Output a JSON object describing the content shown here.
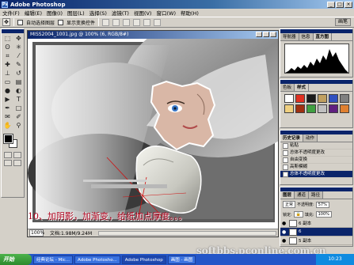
{
  "window": {
    "title": "Adobe Photoshop",
    "min": "_",
    "max": "□",
    "close": "×"
  },
  "menu": [
    "文件(F)",
    "编辑(E)",
    "图像(I)",
    "图层(L)",
    "选择(S)",
    "滤镜(T)",
    "视图(V)",
    "窗口(W)",
    "帮助(H)"
  ],
  "options": {
    "auto_select": "自动选择图层",
    "show_bounds": "显示变换控件",
    "right_tab": "画笔"
  },
  "document": {
    "title": "MISS2004_1001.jpg @ 100% (6, RGB/8#)",
    "zoom": "100%",
    "doc_size": "文档:1.98M/9.24M",
    "caption": "10、加阴影，加渐变，给纸加点厚度。。。"
  },
  "navigator": {
    "tabs": [
      "导航器",
      "信息",
      "直方图"
    ]
  },
  "styles": {
    "tabs": [
      "色板",
      "样式"
    ],
    "swatch_colors": [
      "#ffffff",
      "#e03020",
      "#1a1a1a",
      "#c0a060",
      "#3050c0",
      "#808080",
      "#f0d080",
      "#a03010",
      "#40a040",
      "#c0c0c0",
      "#602080",
      "#e08030"
    ]
  },
  "history": {
    "tabs": [
      "历史记录",
      "动作"
    ],
    "items": [
      "粘贴",
      "总体不透明度更改",
      "自由变换",
      "高斯模糊",
      "总体不透明度更改"
    ]
  },
  "layers": {
    "tabs": [
      "图层",
      "通道",
      "路径"
    ],
    "blend_mode": "正常",
    "opacity_label": "不透明度:",
    "opacity": "57%",
    "lock_label": "锁定:",
    "fill_label": "填充:",
    "fill": "100%",
    "items": [
      "6 副本",
      "6",
      "5 副本",
      "5"
    ]
  },
  "taskbar": {
    "start": "开始",
    "tasks": [
      "经典论坛 - Mic...",
      "Adobe Photosho...",
      "Adobe Photoshop",
      "画图 - 画图"
    ],
    "tray_time": "10:23"
  },
  "watermark": "softbbs.pconline.com.cn",
  "colors": {
    "titlebar": "#0a246a",
    "caption": "#b0001c",
    "taskbar": "#2356c8"
  }
}
